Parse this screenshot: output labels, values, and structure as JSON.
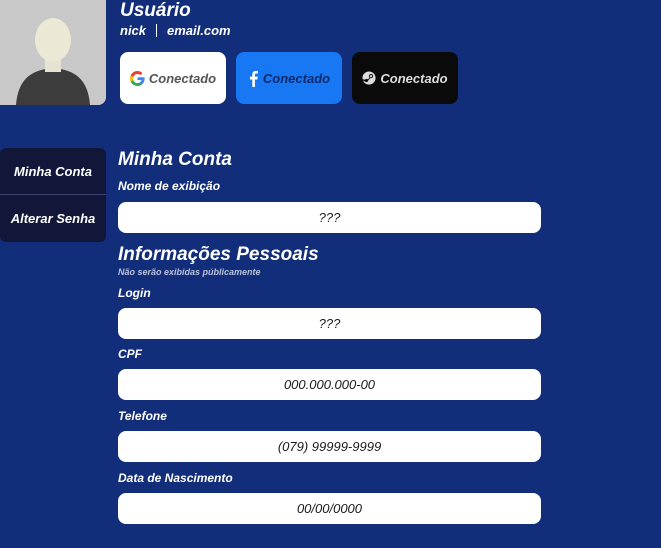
{
  "user": {
    "title": "Usuário",
    "nick": "nick",
    "email": "email.com"
  },
  "connections": [
    {
      "provider_icon": "google-icon",
      "label": "Conectado",
      "color": "#ffffff"
    },
    {
      "provider_icon": "facebook-icon",
      "label": "Conectado",
      "color": "#1877f2"
    },
    {
      "provider_icon": "steam-icon",
      "label": "Conectado",
      "color": "#0a0a0a"
    }
  ],
  "sidebar": {
    "items": [
      {
        "label": "Minha Conta"
      },
      {
        "label": "Alterar Senha"
      }
    ]
  },
  "account": {
    "title": "Minha Conta",
    "display_name_label": "Nome de exibição",
    "display_name_value": "???"
  },
  "personal": {
    "title": "Informações Pessoais",
    "subtitle": "Não serão exibidas públicamente",
    "login_label": "Login",
    "login_value": "???",
    "cpf_label": "CPF",
    "cpf_value": "000.000.000-00",
    "phone_label": "Telefone",
    "phone_value": "(079) 99999-9999",
    "birth_label": "Data de Nascimento",
    "birth_value": "00/00/0000"
  },
  "colors": {
    "background": "#122e7a",
    "sidebar": "#12173a"
  }
}
